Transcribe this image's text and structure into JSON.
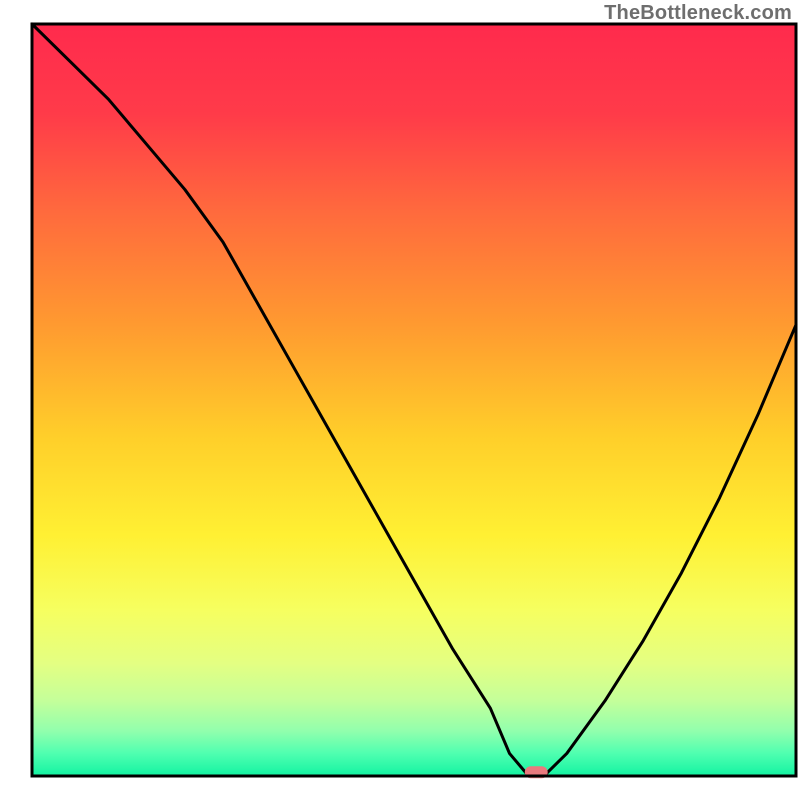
{
  "watermark": "TheBottleneck.com",
  "chart_data": {
    "type": "line",
    "title": "",
    "xlabel": "",
    "ylabel": "",
    "xlim": [
      0,
      100
    ],
    "ylim": [
      0,
      100
    ],
    "grid": false,
    "legend": false,
    "x": [
      0,
      5,
      10,
      15,
      20,
      25,
      30,
      35,
      40,
      45,
      50,
      55,
      60,
      62.5,
      65,
      67,
      70,
      75,
      80,
      85,
      90,
      95,
      100
    ],
    "values": [
      100,
      95,
      90,
      84,
      78,
      71,
      62,
      53,
      44,
      35,
      26,
      17,
      9,
      3,
      0,
      0,
      3,
      10,
      18,
      27,
      37,
      48,
      60
    ],
    "marker": {
      "x": 66,
      "y": 0.5,
      "width": 3.0,
      "height": 1.6
    },
    "axes_box": {
      "x0": 4,
      "y0": 3,
      "x1": 99.5,
      "y1": 97
    },
    "background": {
      "type": "vertical_gradient",
      "stops": [
        {
          "offset": 0,
          "color": "#ff2a4d"
        },
        {
          "offset": 12,
          "color": "#ff3b49"
        },
        {
          "offset": 25,
          "color": "#ff6a3d"
        },
        {
          "offset": 40,
          "color": "#ff9a30"
        },
        {
          "offset": 55,
          "color": "#ffcf2a"
        },
        {
          "offset": 68,
          "color": "#fff033"
        },
        {
          "offset": 78,
          "color": "#f6ff60"
        },
        {
          "offset": 85,
          "color": "#e4ff82"
        },
        {
          "offset": 90,
          "color": "#c4ff9a"
        },
        {
          "offset": 94,
          "color": "#92ffad"
        },
        {
          "offset": 97,
          "color": "#4fffb0"
        },
        {
          "offset": 100,
          "color": "#13f3a2"
        }
      ]
    },
    "line_color": "#000000",
    "marker_color": "#e97a7e",
    "frame_color": "#000000"
  }
}
